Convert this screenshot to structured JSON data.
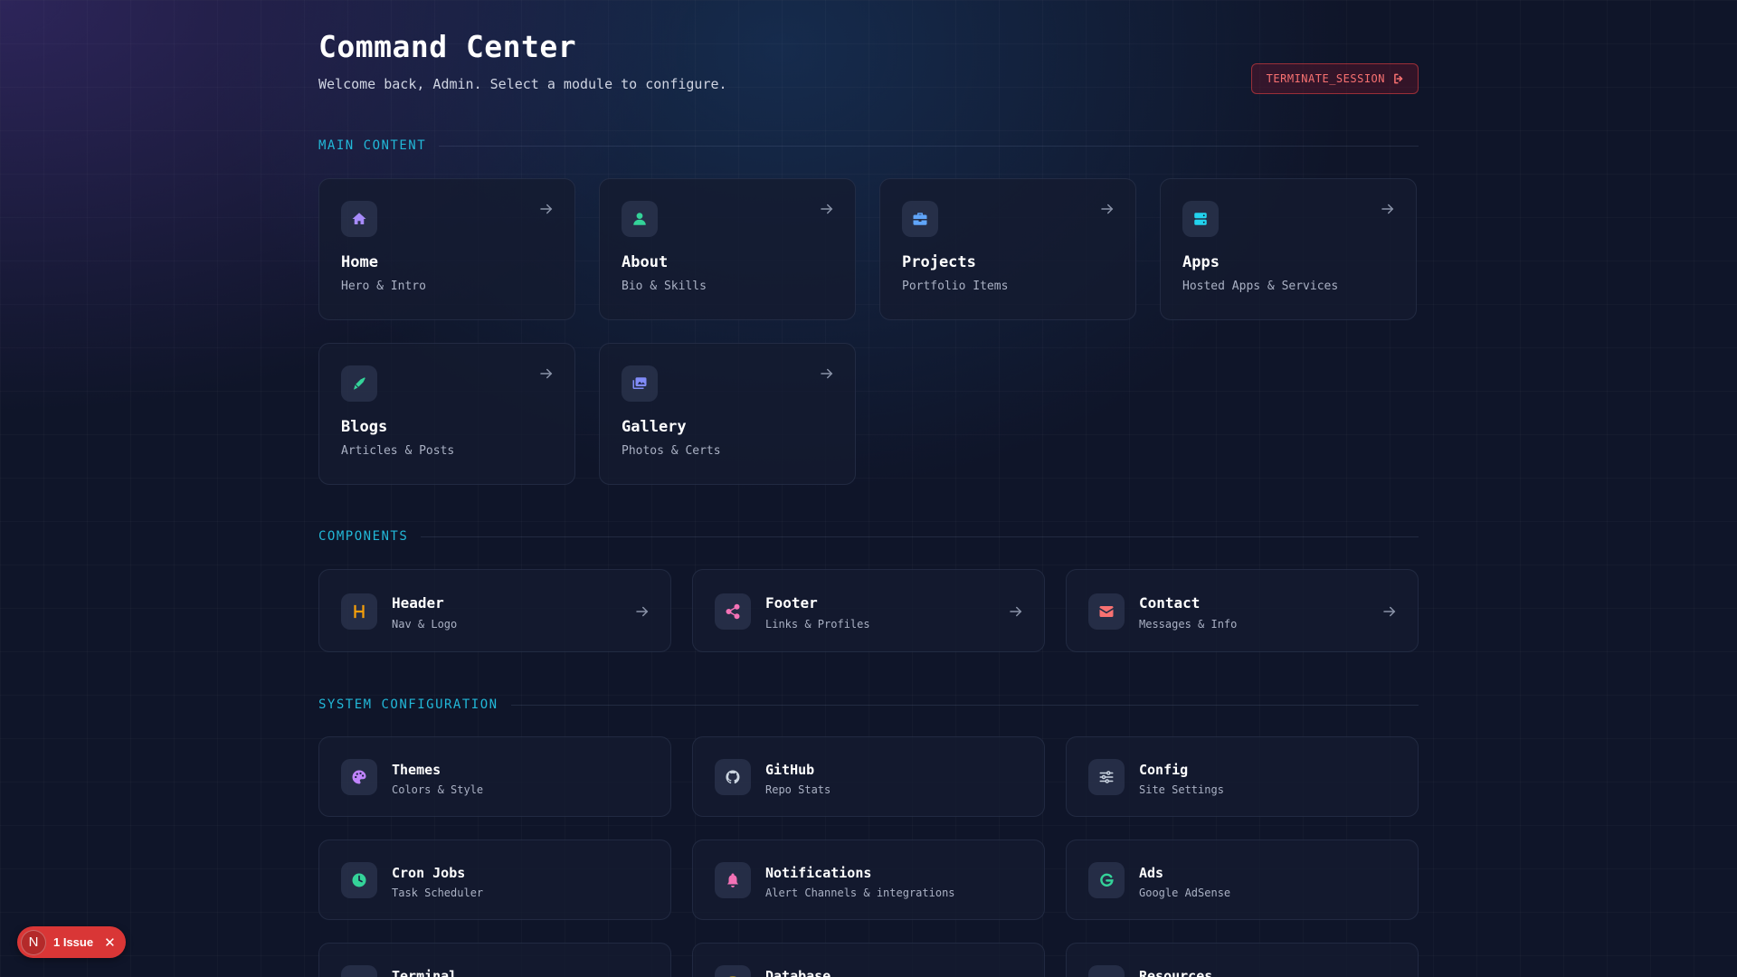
{
  "header": {
    "title": "Command Center",
    "subtitle": "Welcome back, Admin. Select a module to configure.",
    "terminate_label": "TERMINATE_SESSION"
  },
  "sections": {
    "main": "MAIN CONTENT",
    "components": "COMPONENTS",
    "system": "SYSTEM CONFIGURATION"
  },
  "main_cards": [
    {
      "title": "Home",
      "sub": "Hero & Intro",
      "icon": "home-icon",
      "color": "#a78bfa"
    },
    {
      "title": "About",
      "sub": "Bio & Skills",
      "icon": "user-icon",
      "color": "#34d399"
    },
    {
      "title": "Projects",
      "sub": "Portfolio Items",
      "icon": "briefcase-icon",
      "color": "#60a5fa"
    },
    {
      "title": "Apps",
      "sub": "Hosted Apps & Services",
      "icon": "server-icon",
      "color": "#22d3ee"
    },
    {
      "title": "Blogs",
      "sub": "Articles & Posts",
      "icon": "pen-icon",
      "color": "#34d399"
    },
    {
      "title": "Gallery",
      "sub": "Photos & Certs",
      "icon": "images-icon",
      "color": "#818cf8"
    }
  ],
  "component_cards": [
    {
      "title": "Header",
      "sub": "Nav & Logo",
      "icon": "h-letter-icon",
      "color": "#f59e0b"
    },
    {
      "title": "Footer",
      "sub": "Links & Profiles",
      "icon": "share-icon",
      "color": "#f472b6"
    },
    {
      "title": "Contact",
      "sub": "Messages & Info",
      "icon": "envelope-icon",
      "color": "#f87171"
    }
  ],
  "system_cards": [
    {
      "title": "Themes",
      "sub": "Colors & Style",
      "icon": "palette-icon",
      "color": "#c084fc"
    },
    {
      "title": "GitHub",
      "sub": "Repo Stats",
      "icon": "github-icon",
      "color": "#cbd5e1"
    },
    {
      "title": "Config",
      "sub": "Site Settings",
      "icon": "sliders-icon",
      "color": "#cbd5e1"
    },
    {
      "title": "Cron Jobs",
      "sub": "Task Scheduler",
      "icon": "clock-icon",
      "color": "#34d399"
    },
    {
      "title": "Notifications",
      "sub": "Alert Channels & integrations",
      "icon": "bell-icon",
      "color": "#f472b6"
    },
    {
      "title": "Ads",
      "sub": "Google AdSense",
      "icon": "google-icon",
      "color": "#34d399"
    },
    {
      "title": "Terminal",
      "sub": "",
      "icon": "terminal-icon",
      "color": "#cbd5e1"
    },
    {
      "title": "Database",
      "sub": "",
      "icon": "database-icon",
      "color": "#facc15"
    },
    {
      "title": "Resources",
      "sub": "",
      "icon": "resources-icon",
      "color": "#cbd5e1"
    }
  ],
  "issue_badge": {
    "logo": "N",
    "label": "1 Issue",
    "close": "✕"
  },
  "colors": {
    "accent": "#22b8d8",
    "danger": "#f87171",
    "background": "#0f1529"
  }
}
